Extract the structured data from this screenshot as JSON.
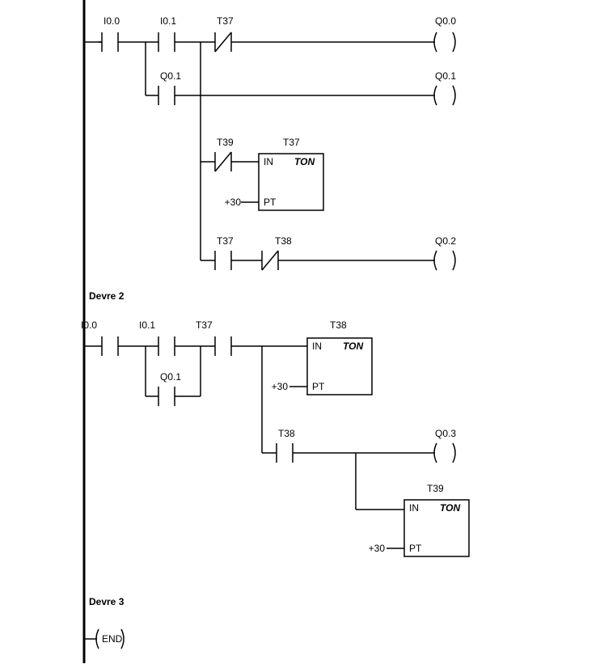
{
  "rung1": {
    "c1": "I0.0",
    "c2": "I0.1",
    "c2b": "Q0.1",
    "nc1": "T37",
    "out1": "Q0.0",
    "out2": "Q0.1",
    "br_nc": "T39",
    "timer1_name": "T37",
    "timer1_in": "IN",
    "timer1_type": "TON",
    "timer1_pt_lbl": "PT",
    "timer1_pt_val": "+30",
    "br2_no": "T37",
    "br2_nc": "T38",
    "out3": "Q0.2"
  },
  "devre2": "Devre 2",
  "rung2": {
    "c1": "I0.0",
    "c2": "I0.1",
    "c2b": "Q0.1",
    "c3": "T37",
    "timer1_name": "T38",
    "timer1_in": "IN",
    "timer1_type": "TON",
    "timer1_pt_lbl": "PT",
    "timer1_pt_val": "+30",
    "br_no": "T38",
    "out1": "Q0.3",
    "timer2_name": "T39",
    "timer2_in": "IN",
    "timer2_type": "TON",
    "timer2_pt_lbl": "PT",
    "timer2_pt_val": "+30"
  },
  "devre3": "Devre 3",
  "end": "END"
}
